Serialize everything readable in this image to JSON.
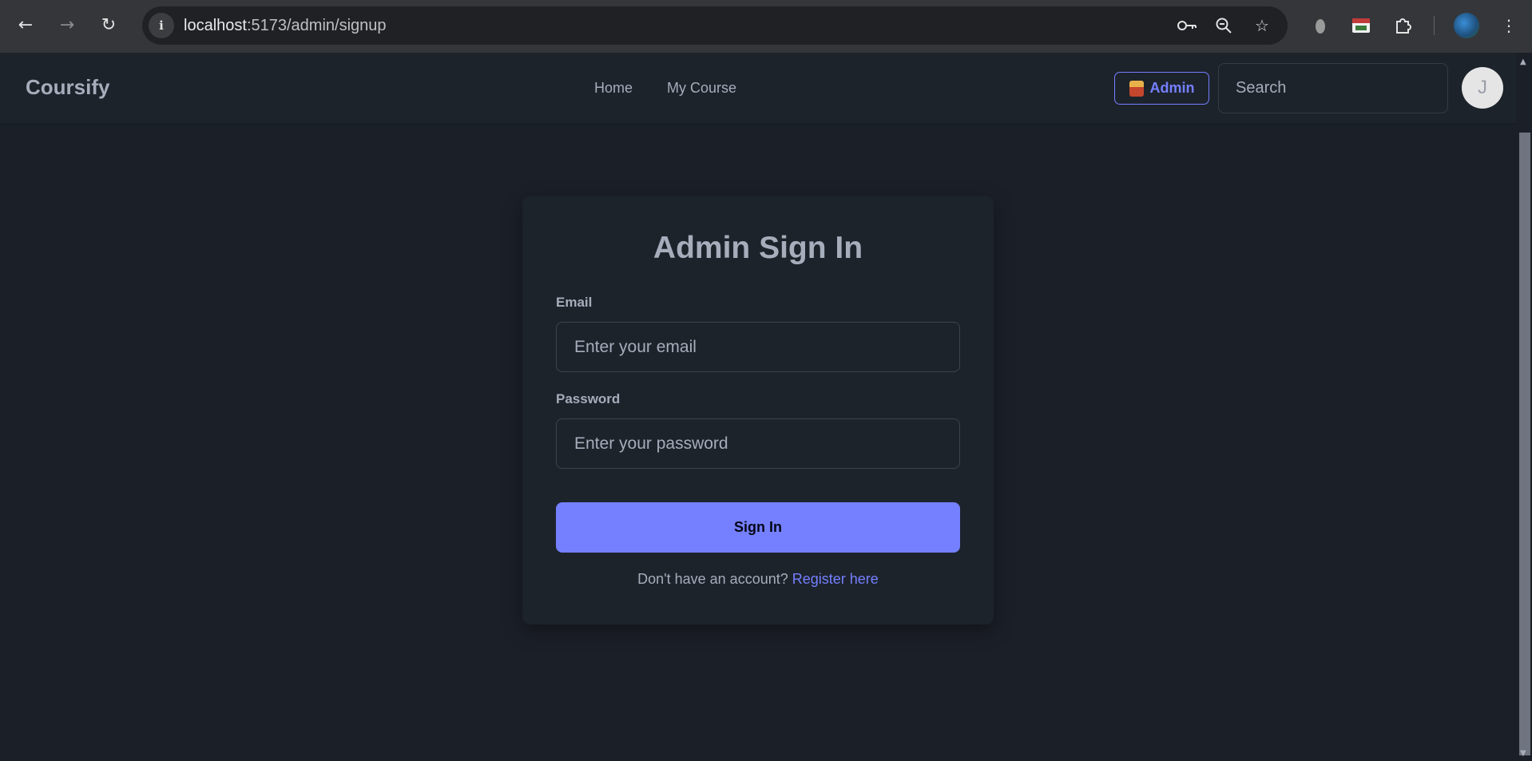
{
  "browser": {
    "url_host": "localhost",
    "url_path": ":5173/admin/signup",
    "icons": [
      "back-icon",
      "forward-icon",
      "reload-icon",
      "site-info-icon",
      "password-key-icon",
      "zoom-icon",
      "bookmark-star-icon",
      "extension-icon",
      "puzzle-icon",
      "menu-icon"
    ]
  },
  "header": {
    "logo": "Coursify",
    "nav": [
      {
        "label": "Home"
      },
      {
        "label": "My Course"
      }
    ],
    "admin_label": "Admin",
    "search_placeholder": "Search",
    "avatar_initial": "J"
  },
  "form": {
    "title": "Admin Sign In",
    "email_label": "Email",
    "email_placeholder": "Enter your email",
    "password_label": "Password",
    "password_placeholder": "Enter your password",
    "submit_label": "Sign In",
    "register_prompt": "Don't have an account? ",
    "register_link": "Register here"
  },
  "colors": {
    "accent": "#7480ff",
    "background": "#1b1f27",
    "surface": "#1d232b",
    "text": "#a6adbb"
  }
}
